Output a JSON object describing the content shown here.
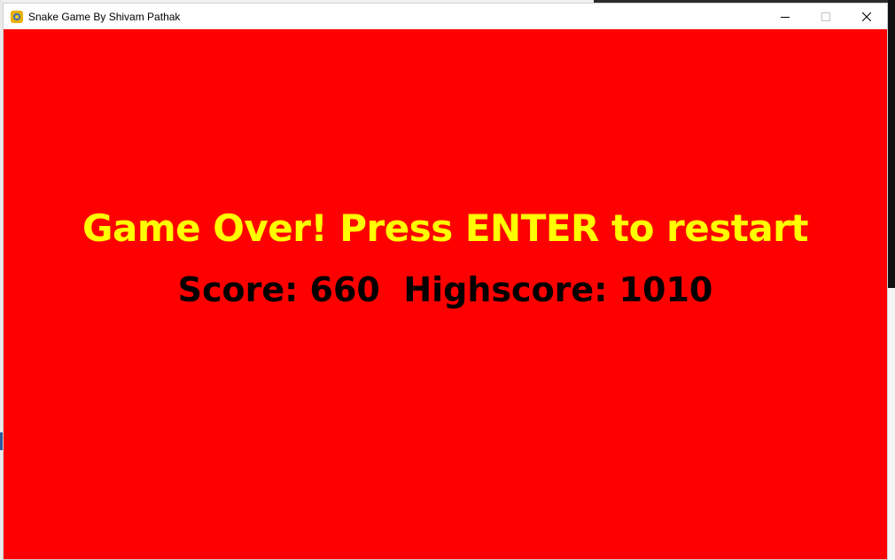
{
  "window": {
    "title": "Snake Game By Shivam Pathak",
    "icon": "python-snake-icon"
  },
  "game": {
    "background_color": "#ff0000",
    "message": "Game Over! Press ENTER to restart",
    "message_color": "#ffff00",
    "score_label": "Score: 660",
    "highscore_label": "Highscore: 1010",
    "score": 660,
    "highscore": 1010
  }
}
